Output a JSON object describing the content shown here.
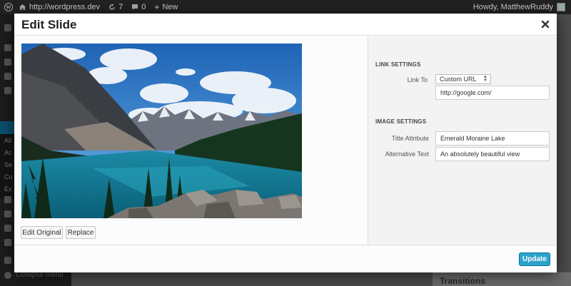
{
  "admin_bar": {
    "site_url": "http://wordpress.dev",
    "updates_count": "7",
    "comments_count": "0",
    "new_label": "New",
    "howdy": "Howdy, MatthewRuddy"
  },
  "sidebar_bg": {
    "sub_items": [
      "All",
      "Ac",
      "Se",
      "Cu",
      "Ex"
    ],
    "collapse_label": "Collapse menu"
  },
  "background_panel": {
    "title": "Transitions"
  },
  "modal": {
    "title": "Edit Slide",
    "close_icon": "close-icon",
    "image_alt": "Mountain lake landscape",
    "buttons": {
      "edit_original": "Edit Original",
      "replace": "Replace"
    },
    "link_settings": {
      "heading": "LINK SETTINGS",
      "link_to_label": "Link To",
      "link_to_value": "Custom URL",
      "url_value": "http://google.com/"
    },
    "image_settings": {
      "heading": "IMAGE SETTINGS",
      "title_label": "Title Attribute",
      "title_value": "Emerald Moraine Lake",
      "alt_label": "Alternative Text",
      "alt_value": "An absolutely beautiful view"
    },
    "update_label": "Update"
  },
  "colors": {
    "primary_button": "#2ea2cc",
    "admin_bar": "#222222"
  }
}
